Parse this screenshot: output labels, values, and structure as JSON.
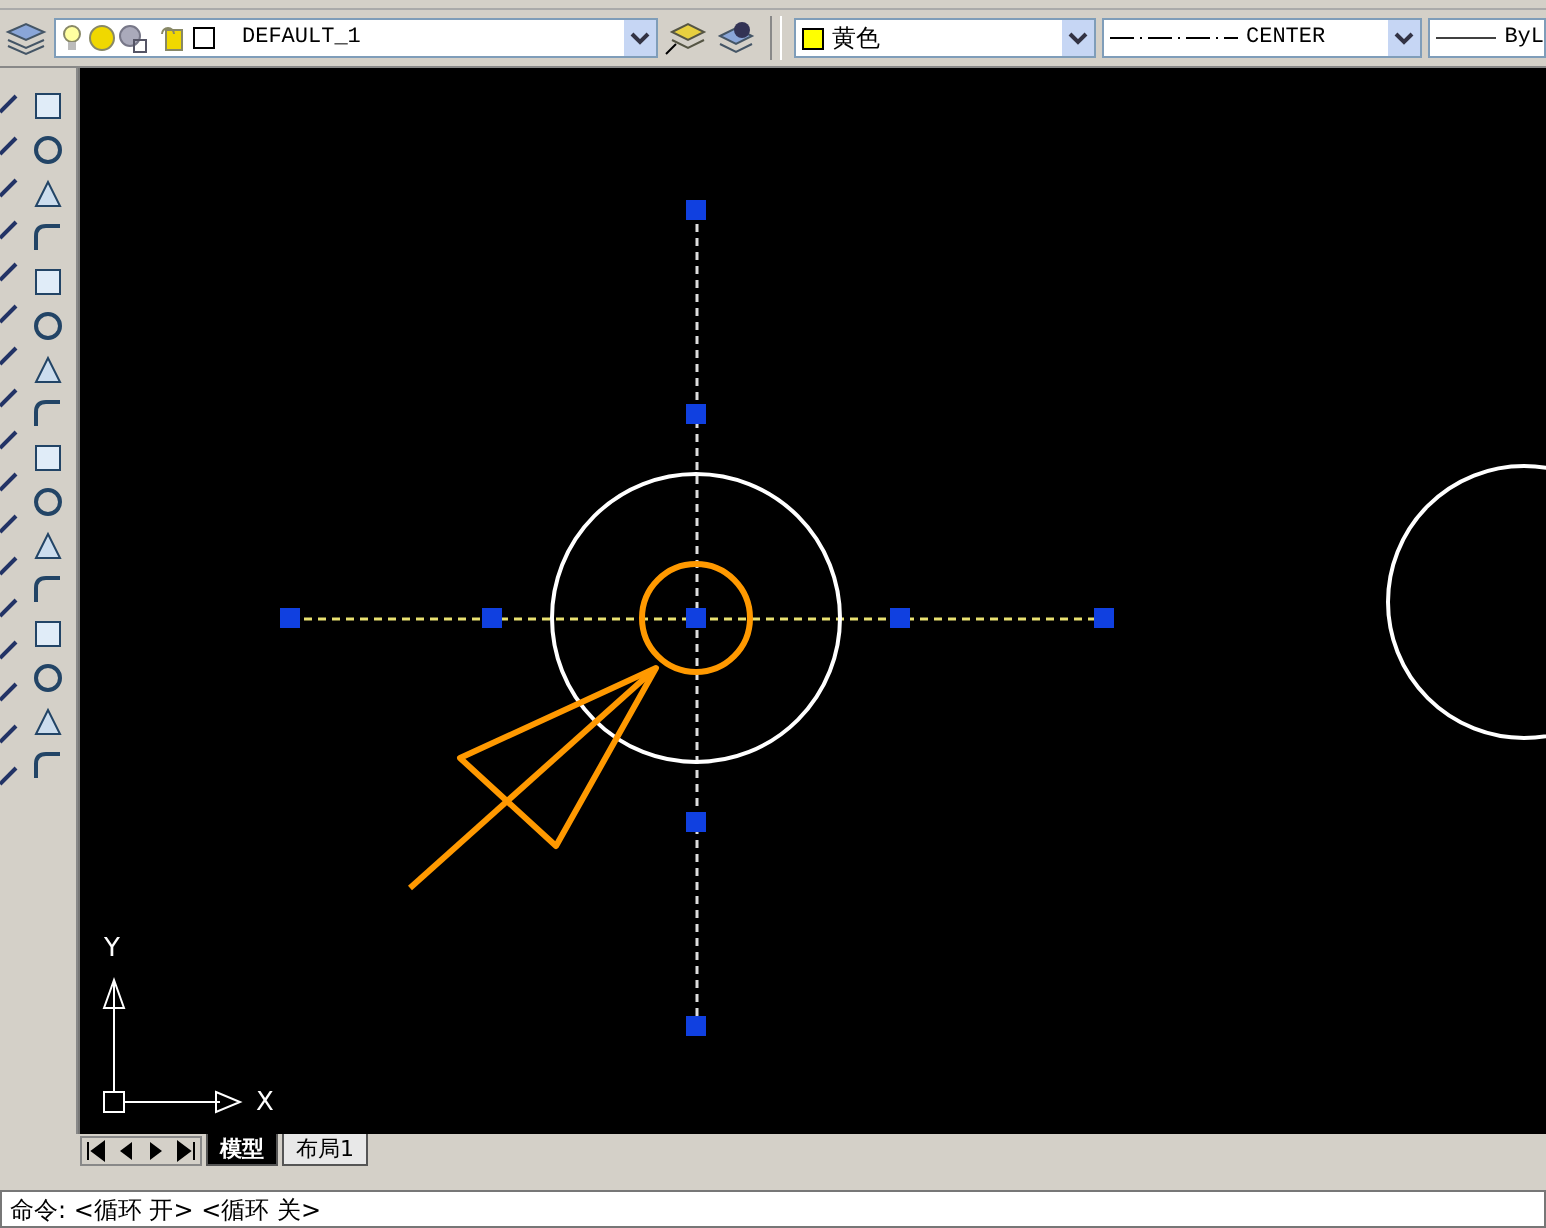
{
  "toolbar": {
    "layer": {
      "name": "DEFAULT_1"
    },
    "color": {
      "name": "黄色",
      "color": "#ffff00"
    },
    "linetype": {
      "name": "CENTER"
    },
    "lineweight": {
      "name": "ByL"
    }
  },
  "canvas": {
    "ucs": {
      "y_label": "Y",
      "x_label": "X"
    }
  },
  "layout_tabs": [
    {
      "label": "模型",
      "selected": true
    },
    {
      "label": "布局1",
      "selected": false
    }
  ],
  "command_line": {
    "text": "命令: <循环 开>  <循环 关>"
  }
}
